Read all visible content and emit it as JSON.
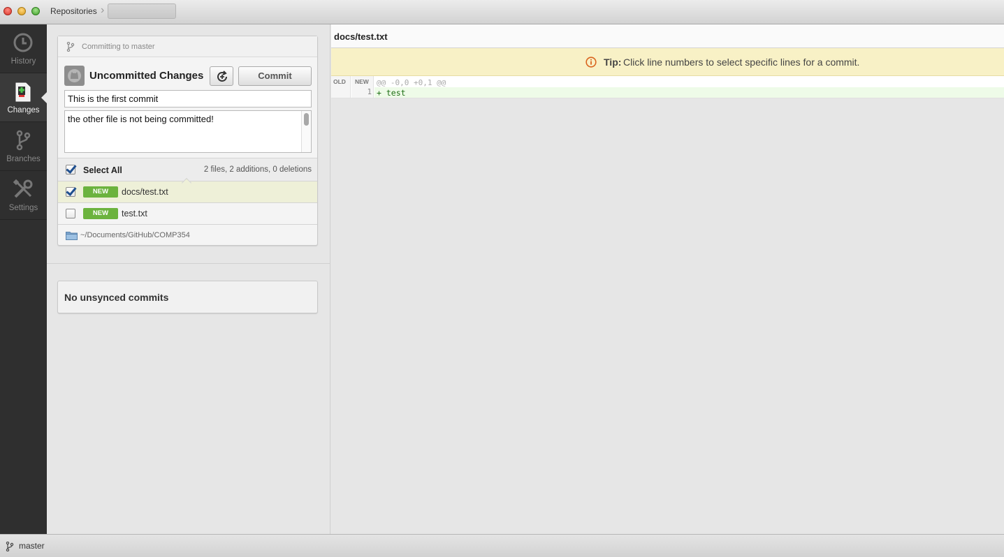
{
  "titlebar": {
    "breadcrumb": "Repositories"
  },
  "nav": [
    {
      "label": "History",
      "icon": "history-icon"
    },
    {
      "label": "Changes",
      "icon": "changes-icon"
    },
    {
      "label": "Branches",
      "icon": "branches-icon"
    },
    {
      "label": "Settings",
      "icon": "settings-icon"
    }
  ],
  "commit": {
    "branch_text": "Committing to master",
    "title": "Uncommitted Changes",
    "commit_button": "Commit",
    "summary_value": "This is the first commit",
    "description_value": "the other file is not being committed!",
    "select_all_label": "Select All",
    "stats": "2 files, 2 additions, 0 deletions",
    "files": [
      {
        "badge": "NEW",
        "name": "docs/test.txt",
        "checked": true
      },
      {
        "badge": "NEW",
        "name": "test.txt",
        "checked": false
      }
    ],
    "repo_path": "~/Documents/GitHub/COMP354"
  },
  "unsynced": {
    "text": "No unsynced commits"
  },
  "diff": {
    "file_title": "docs/test.txt",
    "tip_bold": "Tip:",
    "tip_text": "Click line numbers to select specific lines for a commit.",
    "col_old": "OLD",
    "col_new": "NEW",
    "hunk_header": "@@ -0,0 +0,1 @@",
    "lines": [
      {
        "new_num": "1",
        "text": "+ test"
      }
    ]
  },
  "statusbar": {
    "branch": "master"
  },
  "colors": {
    "badge_new": "#6cb33e",
    "tip_bg": "#f8f1c6",
    "nav_bg": "#2f2f2f",
    "selected_row": "#eef0d8"
  }
}
